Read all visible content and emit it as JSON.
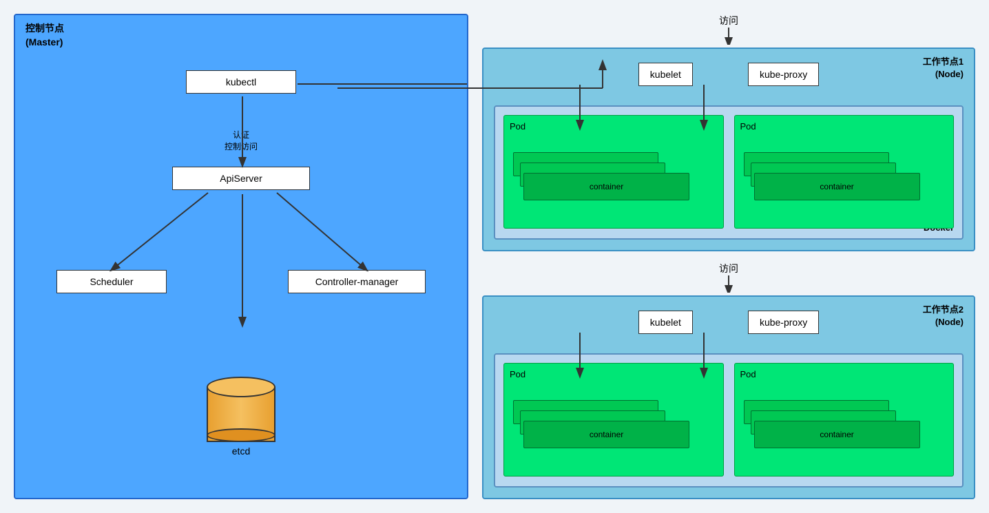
{
  "master": {
    "title_line1": "控制节点",
    "title_line2": "(Master)",
    "kubectl": "kubectl",
    "auth_label_line1": "认证",
    "auth_label_line2": "控制访问",
    "apiserver": "ApiServer",
    "scheduler": "Scheduler",
    "controller": "Controller-manager",
    "etcd": "etcd"
  },
  "worker1": {
    "title_line1": "工作节点1",
    "title_line2": "(Node)",
    "access": "访问",
    "kubelet": "kubelet",
    "kube_proxy": "kube-proxy",
    "docker_label": "Docker",
    "pod1_label": "Pod",
    "pod2_label": "Pod",
    "container_label": "container"
  },
  "worker2": {
    "title_line1": "工作节点2",
    "title_line2": "(Node)",
    "access": "访问",
    "kubelet": "kubelet",
    "kube_proxy": "kube-proxy",
    "pod1_label": "Pod",
    "pod2_label": "Pod",
    "container_label": "container"
  }
}
